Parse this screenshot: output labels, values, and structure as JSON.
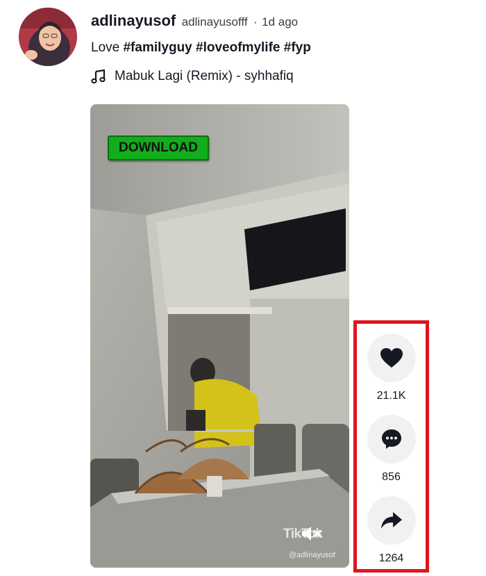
{
  "post": {
    "author_name": "adlinayusof",
    "author_handle": "adlinayusofff",
    "separator": "·",
    "time_ago": "1d ago",
    "caption_text": "Love",
    "hashtags": [
      "#familyguy",
      "#loveofmylife",
      "#fyp"
    ],
    "music_title": "Mabuk Lagi (Remix) - syhhafiq"
  },
  "video": {
    "download_label": "DOWNLOAD",
    "watermark_brand": "TikTok",
    "watermark_user": "@adlinayusof",
    "sound_state": "muted"
  },
  "actions": {
    "like_count": "21.1K",
    "comment_count": "856",
    "share_count": "1264",
    "highlight_color": "#e1141e"
  },
  "icons": [
    "avatar",
    "music-note-icon",
    "mute-icon",
    "heart-icon",
    "comment-icon",
    "share-icon"
  ]
}
